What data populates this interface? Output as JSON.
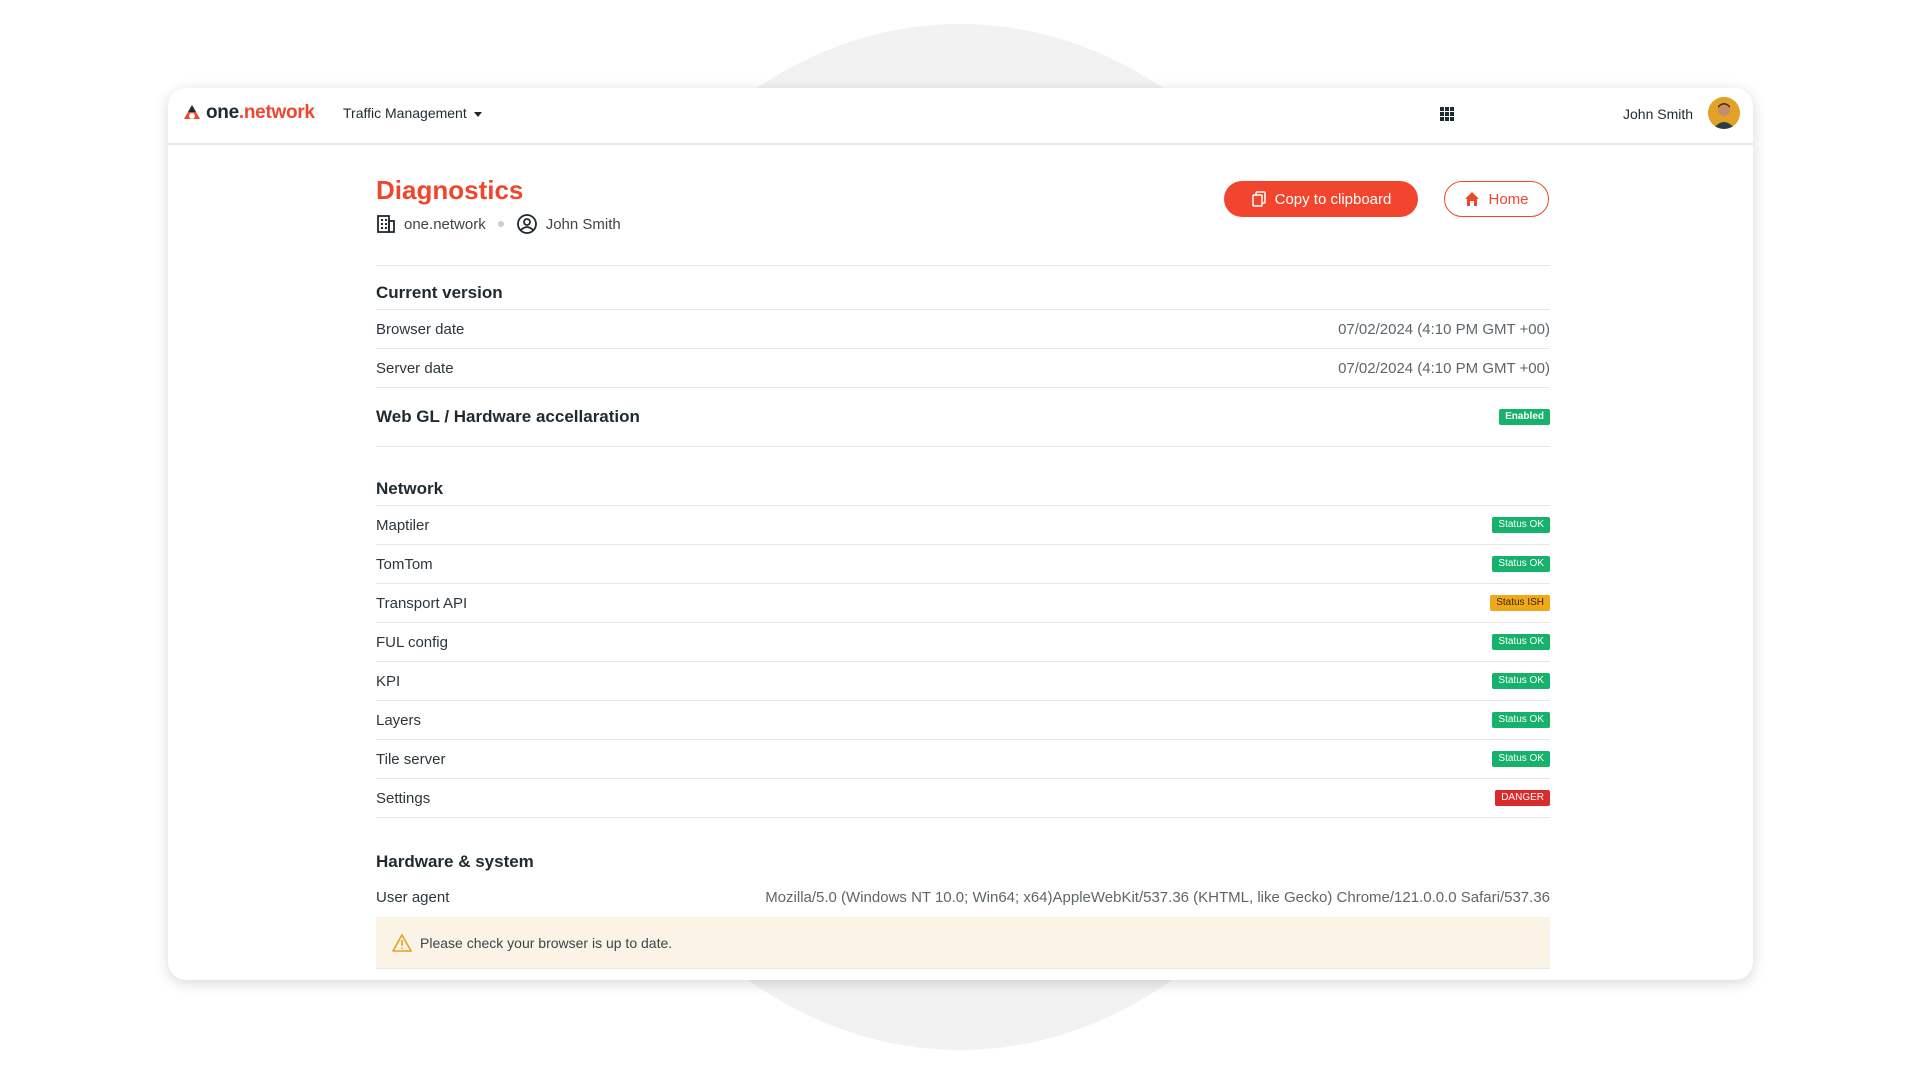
{
  "header": {
    "logo_part1": "one",
    "logo_part2": ".network",
    "app_menu_label": "Traffic Management",
    "user_name": "John Smith"
  },
  "page": {
    "title": "Diagnostics",
    "organization": "one.network",
    "user": "John Smith",
    "copy_button": "Copy to clipboard",
    "home_button": "Home"
  },
  "sections": {
    "current_version": {
      "title": "Current version",
      "rows": [
        {
          "label": "Browser date",
          "value": "07/02/2024 (4:10 PM GMT +00)"
        },
        {
          "label": "Server date",
          "value": "07/02/2024 (4:10 PM GMT +00)"
        }
      ]
    },
    "webgl": {
      "title": "Web GL / Hardware accellaration",
      "status": "Enabled",
      "status_color": "#16b26b"
    },
    "network": {
      "title": "Network",
      "rows": [
        {
          "label": "Maptiler",
          "status": "Status OK",
          "color": "#16b26b"
        },
        {
          "label": "TomTom",
          "status": "Status OK",
          "color": "#16b26b"
        },
        {
          "label": "Transport API",
          "status": "Status ISH",
          "color": "#f0a81b"
        },
        {
          "label": "FUL config",
          "status": "Status OK",
          "color": "#16b26b"
        },
        {
          "label": "KPI",
          "status": "Status OK",
          "color": "#16b26b"
        },
        {
          "label": "Layers",
          "status": "Status OK",
          "color": "#16b26b"
        },
        {
          "label": "Tile server",
          "status": "Status OK",
          "color": "#16b26b"
        },
        {
          "label": "Settings",
          "status": "DANGER",
          "color": "#d92b2b"
        }
      ]
    },
    "hardware": {
      "title": "Hardware & system",
      "user_agent_label": "User agent",
      "user_agent_value": "Mozilla/5.0 (Windows NT 10.0; Win64; x64)AppleWebKit/537.36 (KHTML, like Gecko) Chrome/121.0.0.0 Safari/537.36",
      "warning": "Please check your browser is up to date."
    }
  },
  "colors": {
    "brand": "#f1462d",
    "ok": "#16b26b",
    "warn": "#f0a81b",
    "danger": "#d92b2b",
    "warning_bg": "#fbf3e6"
  }
}
